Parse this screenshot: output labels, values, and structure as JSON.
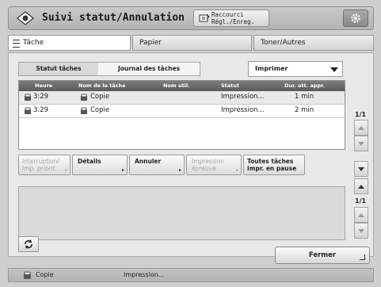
{
  "header": {
    "title": "Suivi statut/Annulation",
    "shortcut_line1": "Raccourci",
    "shortcut_line2": "Régl./Enreg.",
    "settings_icon": "gear-icon"
  },
  "tabs": [
    {
      "label": "Tâche",
      "active": true
    },
    {
      "label": "Papier",
      "active": false
    },
    {
      "label": "Toner/Autres",
      "active": false
    }
  ],
  "subtabs": [
    {
      "label": "Statut tâches",
      "active": true
    },
    {
      "label": "Journal des tâches",
      "active": false
    }
  ],
  "filter": {
    "selected": "Imprimer"
  },
  "list": {
    "columns": [
      "Heure",
      "Nom de la tâche",
      "Nom util.",
      "Statut",
      "Dur. att. appr."
    ],
    "rows": [
      {
        "time": "3:29",
        "name": "Copie",
        "user": "",
        "status": "Impression...",
        "wait": "1 min"
      },
      {
        "time": "3:29",
        "name": "Copie",
        "user": "",
        "status": "Impression...",
        "wait": "2 min"
      }
    ],
    "page": "1/1"
  },
  "actions": {
    "interrupt_line1": "Interruption/",
    "interrupt_line2": "Imp. priorit.",
    "details": "Détails",
    "cancel": "Annuler",
    "print_sample_line1": "Impression",
    "print_sample_line2": "épreuve",
    "pause_line1": "Toutes tâches",
    "pause_line2": "impr. en pause"
  },
  "detail_pager": "1/1",
  "close_label": "Fermer",
  "statusbar": {
    "job": "Copie",
    "status": "Impression..."
  }
}
